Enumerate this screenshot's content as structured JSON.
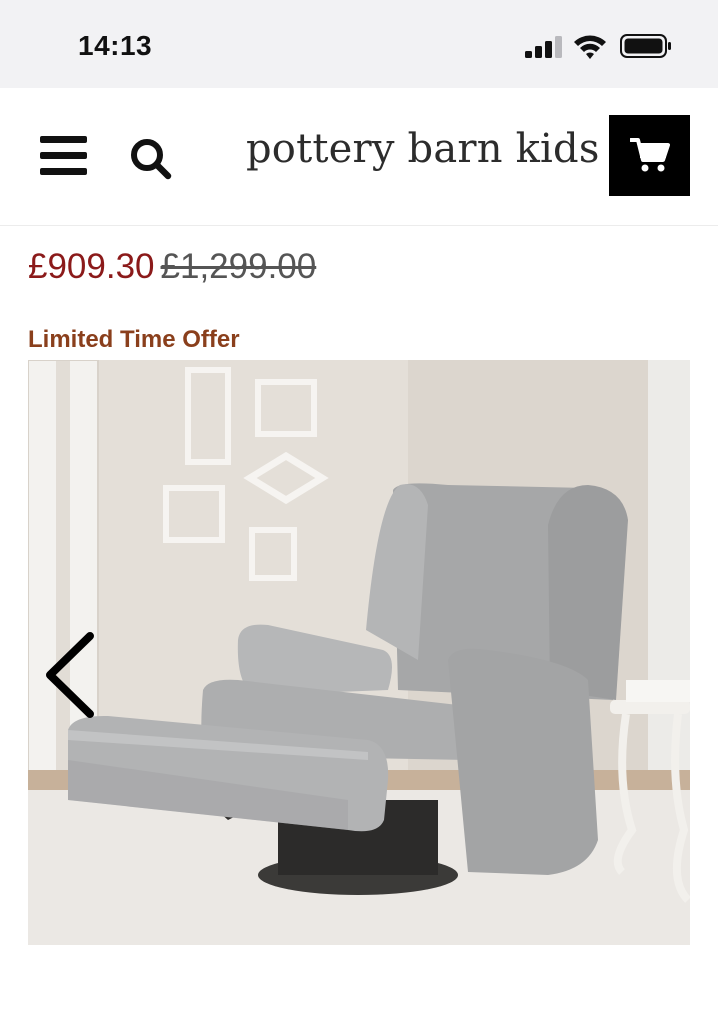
{
  "status_bar": {
    "time": "14:13",
    "icons": [
      "cellular-signal-icon",
      "wifi-icon",
      "battery-icon"
    ]
  },
  "header": {
    "brand": "pottery barn kids",
    "menu_icon": "hamburger-menu-icon",
    "search_icon": "search-icon",
    "cart_icon": "shopping-cart-icon"
  },
  "product": {
    "sale_price": "£909.30",
    "original_price": "£1,299.00",
    "promo_label": "Limited Time Offer",
    "image": {
      "alt": "Grey upholstered swivel glider recliner with footrest extended",
      "prev_icon": "chevron-left-icon"
    }
  },
  "colors": {
    "sale_price": "#8b1a1a",
    "promo_label": "#8a3f1c",
    "cart_background": "#000000",
    "status_bar_background": "#f2f2f4"
  }
}
